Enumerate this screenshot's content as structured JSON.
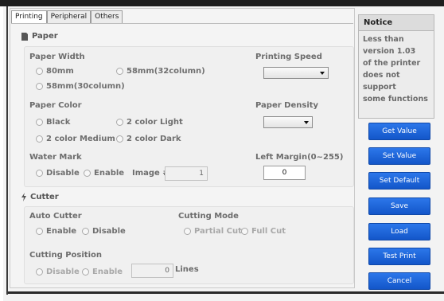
{
  "tabs": [
    "Printing",
    "Peripheral",
    "Others"
  ],
  "paper": {
    "section_title": "Paper",
    "width_label": "Paper Width",
    "width_opt1": "80mm",
    "width_opt2": "58mm(32column)",
    "width_opt3": "58mm(30column)",
    "speed_label": "Printing Speed",
    "color_label": "Paper Color",
    "color_opt1": "Black",
    "color_opt2": "2 color Light",
    "color_opt3": "2 color Medium",
    "color_opt4": "2 color Dark",
    "density_label": "Paper Density",
    "watermark_label": "Water Mark",
    "wm_disable": "Disable",
    "wm_enable": "Enable",
    "image_label": "Image #",
    "image_value": "1",
    "left_margin_label": "Left Margin(0~255)",
    "left_margin_value": "0"
  },
  "cutter": {
    "section_title": "Cutter",
    "auto_label": "Auto Cutter",
    "auto_enable": "Enable",
    "auto_disable": "Disable",
    "mode_label": "Cutting Mode",
    "mode_partial": "Partial Cut",
    "mode_full": "Full Cut",
    "position_label": "Cutting Position",
    "pos_disable": "Disable",
    "pos_enable": "Enable",
    "pos_value": "0",
    "lines_label": "Lines"
  },
  "notice": {
    "title": "Notice",
    "line1": "Less than",
    "line2": "version 1.03",
    "line3": "of the printer",
    "line4": "does not support",
    "line5": "some functions"
  },
  "buttons": {
    "get": "Get Value",
    "set": "Set Value",
    "default": "Set Default",
    "save": "Save",
    "load": "Load",
    "test": "Test Print",
    "cancel": "Cancel"
  },
  "colors": {
    "button_blue": "#1a64da",
    "text_gray": "#6c6c6c"
  },
  "icons": {
    "paper": "document-icon",
    "cutter": "lightning-icon"
  }
}
